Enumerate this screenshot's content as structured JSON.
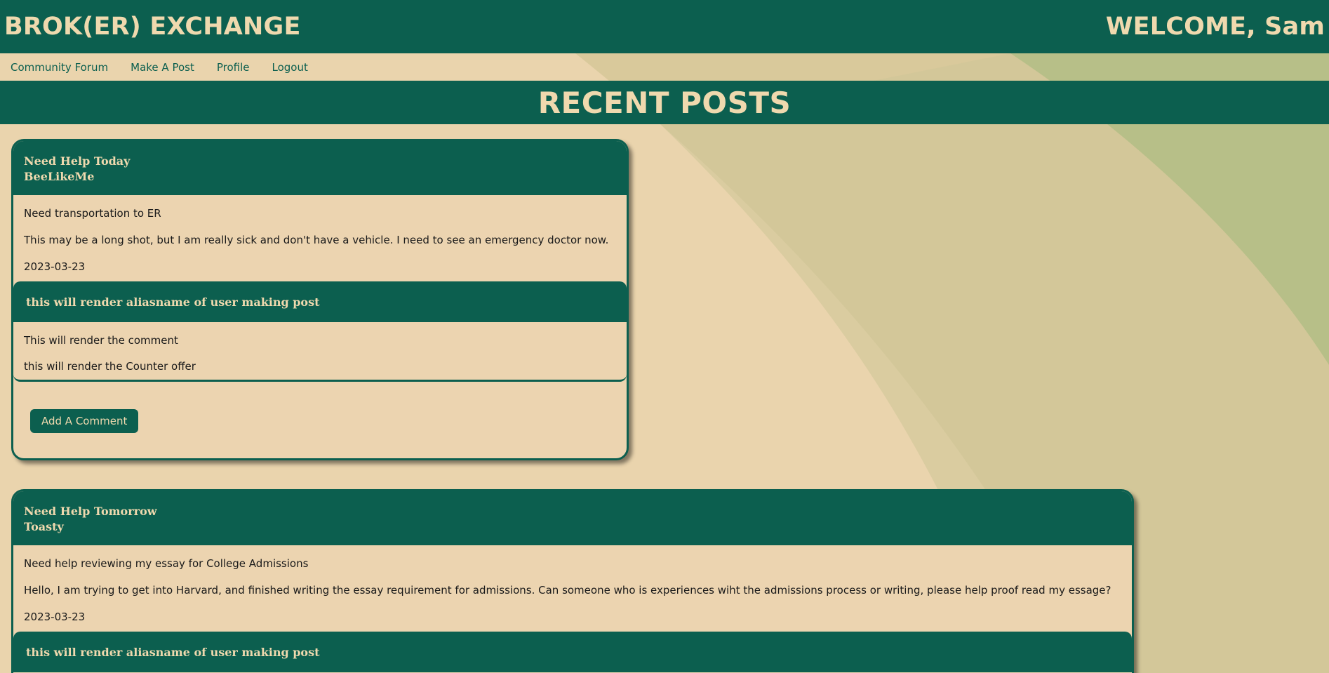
{
  "header": {
    "site_title": "BROK(ER) EXCHANGE",
    "welcome_text": "WELCOME, Sam"
  },
  "nav": {
    "items": [
      {
        "label": "Community Forum"
      },
      {
        "label": "Make A Post"
      },
      {
        "label": "Profile"
      },
      {
        "label": "Logout"
      }
    ]
  },
  "section": {
    "title": "RECENT POSTS"
  },
  "posts": [
    {
      "title": "Need Help Today",
      "author": "BeeLikeMe",
      "subject": "Need transportation to ER",
      "body": "This may be a long shot, but I am really sick and don't have a vehicle. I need to see an emergency doctor now.",
      "date": "2023-03-23",
      "comment": {
        "author": "this will render aliasname of user making post",
        "text": "This will render the comment",
        "counter_offer": "this will render the Counter offer"
      },
      "add_comment_label": "Add A Comment"
    },
    {
      "title": "Need Help Tomorrow",
      "author": "Toasty",
      "subject": "Need help reviewing my essay for College Admissions",
      "body": "Hello, I am trying to get into Harvard, and finished writing the essay requirement for admissions. Can someone who is experiences wiht the admissions process or writing, please help proof read my essage?",
      "date": "2023-03-23",
      "comment": {
        "author": "this will render aliasname of user making post"
      }
    }
  ],
  "colors": {
    "primary": "#0c5f4f",
    "accent_text": "#efd9ae",
    "background": "#e9d4ac"
  }
}
